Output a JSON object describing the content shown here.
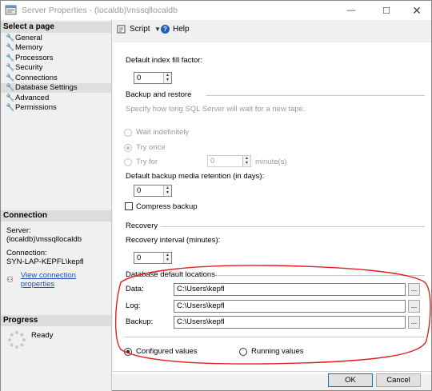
{
  "window": {
    "title": "Server Properties - (localdb)\\mssqllocaldb",
    "minimize_glyph": "—",
    "maximize_glyph": "☐",
    "close_glyph": "✕"
  },
  "left_panel": {
    "select_page_header": "Select a page",
    "pages": [
      {
        "label": "General",
        "selected": false
      },
      {
        "label": "Memory",
        "selected": false
      },
      {
        "label": "Processors",
        "selected": false
      },
      {
        "label": "Security",
        "selected": false
      },
      {
        "label": "Connections",
        "selected": false
      },
      {
        "label": "Database Settings",
        "selected": true
      },
      {
        "label": "Advanced",
        "selected": false
      },
      {
        "label": "Permissions",
        "selected": false
      }
    ],
    "connection_header": "Connection",
    "server_label": "Server:",
    "server_value": "(localdb)\\mssqllocaldb",
    "connection_label": "Connection:",
    "connection_value": "SYN-LAP-KEPFL\\kepfl",
    "view_link": "View connection properties",
    "progress_header": "Progress",
    "progress_status": "Ready"
  },
  "toolbar": {
    "script_label": "Script",
    "help_label": "Help"
  },
  "settings": {
    "fill_factor_label": "Default index fill factor:",
    "fill_factor_value": "0",
    "backup_restore_group": "Backup and restore",
    "backup_wait_hint": "Specify how long SQL Server will wait for a new tape.",
    "wait_indefinitely": "Wait indefinitely",
    "try_once": "Try once",
    "try_for": "Try for",
    "try_for_value": "0",
    "minutes_label": "minute(s)",
    "retention_label": "Default backup media retention (in days):",
    "retention_value": "0",
    "compress_backup": "Compress backup",
    "recovery_group": "Recovery",
    "recovery_interval_label": "Recovery interval (minutes):",
    "recovery_interval_value": "0",
    "db_locations_group": "Database default locations",
    "data_label": "Data:",
    "data_value": "C:\\Users\\kepfl",
    "log_label": "Log:",
    "log_value": "C:\\Users\\kepfl",
    "backup_label": "Backup:",
    "backup_value": "C:\\Users\\kepfl",
    "browse_glyph": "...",
    "configured_values": "Configured values",
    "running_values": "Running values"
  },
  "footer": {
    "ok_label": "OK",
    "cancel_label": "Cancel"
  },
  "colors": {
    "annotation": "#e02020",
    "link": "#1a4fb5",
    "help_icon": "#1f5fbf"
  }
}
